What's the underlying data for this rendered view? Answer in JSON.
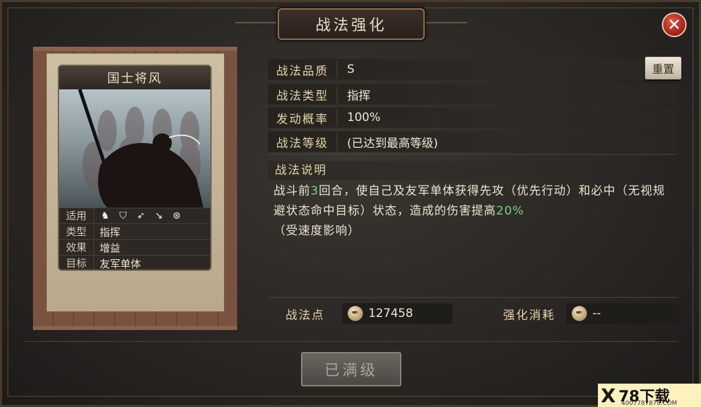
{
  "window": {
    "title": "战法强化"
  },
  "card": {
    "name": "国士将风",
    "rows": [
      {
        "label": "适用",
        "icons": [
          "cavalry-icon",
          "shield-icon",
          "bow-icon",
          "spear-icon",
          "wheel-icon"
        ]
      },
      {
        "label": "类型",
        "value": "指挥"
      },
      {
        "label": "效果",
        "value": "增益"
      },
      {
        "label": "目标",
        "value": "友军单体"
      }
    ]
  },
  "info": {
    "quality_label": "战法品质",
    "quality_value": "S",
    "type_label": "战法类型",
    "type_value": "指挥",
    "chance_label": "发动概率",
    "chance_value": "100%",
    "level_label": "战法等级",
    "level_value": "(已达到最高等级)",
    "reset_label": "重置"
  },
  "description": {
    "label": "战法说明",
    "part1": "战斗前",
    "turns": "3",
    "part2": "回合，使自己及友军单体获得先攻（优先行动）和必中（无视规避状态命中目标）状态，造成的伤害提高",
    "boost": "20%",
    "part3": "（受速度影响）"
  },
  "points": {
    "label": "战法点",
    "value": "127458",
    "cost_label": "强化消耗",
    "cost_value": "--"
  },
  "max_button": "已满级",
  "watermark": {
    "brand": "78下载",
    "url": "4007787878.COM"
  },
  "colors": {
    "accent_text": "#e6d3a8",
    "highlight": "#7fcf86",
    "close_red": "#a11d14"
  }
}
